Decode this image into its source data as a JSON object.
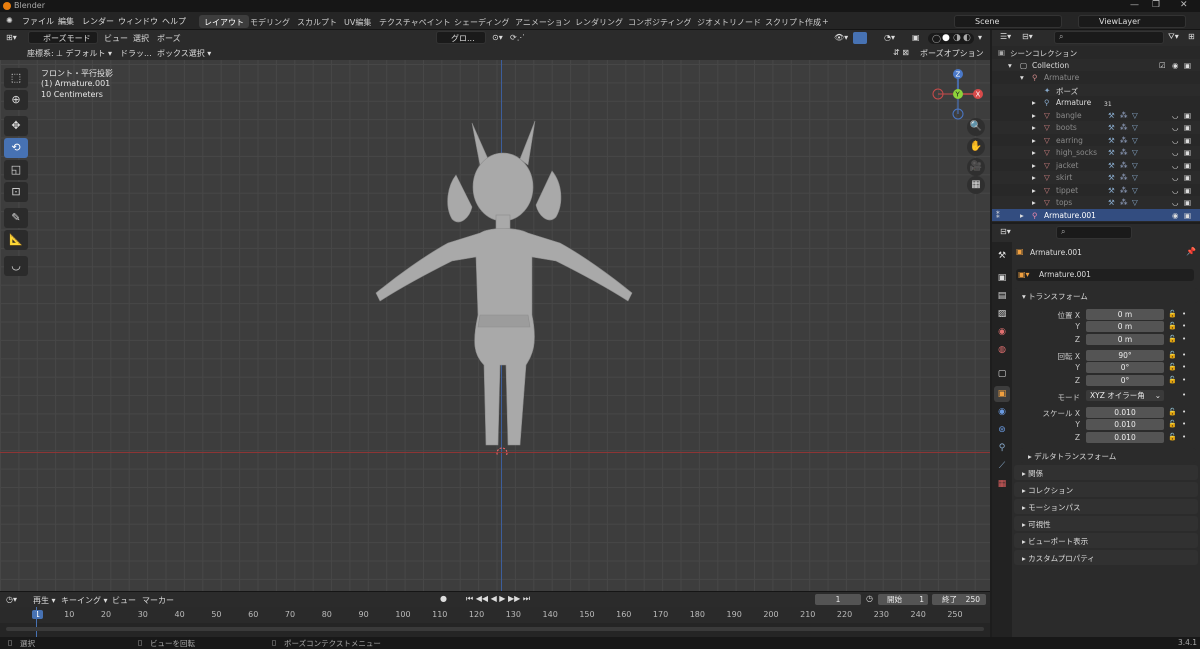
{
  "window": {
    "title": "Blender",
    "version": "3.4.1"
  },
  "menu": [
    "ファイル",
    "編集",
    "レンダー",
    "ウィンドウ",
    "ヘルプ"
  ],
  "workspaces": [
    "レイアウト",
    "モデリング",
    "スカルプト",
    "UV編集",
    "テクスチャペイント",
    "シェーディング",
    "アニメーション",
    "レンダリング",
    "コンポジティング",
    "ジオメトリノード",
    "スクリプト作成"
  ],
  "scene": {
    "name": "Scene",
    "view_layer": "ViewLayer"
  },
  "viewport_header": {
    "mode": "ポーズモード",
    "items": [
      "ビュー",
      "選択",
      "ポーズ"
    ],
    "orientation": "グロ...",
    "pose_options": "ポーズオプション"
  },
  "viewport_header2": {
    "coord_label": "座標系:",
    "coord_value": "デフォルト",
    "drag_label": "ドラッ...",
    "select_mode": "ボックス選択"
  },
  "overlay_text": {
    "view": "フロント・平行投影",
    "object": "(1) Armature.001",
    "scale": "10 Centimeters"
  },
  "gizmo": {
    "x": "X",
    "y": "Y",
    "z": "Z"
  },
  "timeline": {
    "play_label": "再生",
    "keying_label": "キーイング",
    "view_label": "ビュー",
    "marker_label": "マーカー",
    "current_frame": "1",
    "start_label": "開始",
    "start": "1",
    "end_label": "終了",
    "end": "250",
    "ticks": [
      "1",
      "10",
      "20",
      "30",
      "40",
      "50",
      "60",
      "70",
      "80",
      "90",
      "100",
      "110",
      "120",
      "130",
      "140",
      "150",
      "160",
      "170",
      "180",
      "190",
      "200",
      "210",
      "220",
      "230",
      "240",
      "250"
    ]
  },
  "statusbar": {
    "select": "選択",
    "rotate": "ビューを回転",
    "context": "ポーズコンテクストメニュー"
  },
  "outliner": {
    "scene_collection": "シーンコレクション",
    "rows": [
      {
        "label": "Collection"
      },
      {
        "label": "Armature"
      },
      {
        "label": "ポーズ"
      },
      {
        "label": "Armature",
        "badge": "31"
      },
      {
        "label": "bangle"
      },
      {
        "label": "boots"
      },
      {
        "label": "earring"
      },
      {
        "label": "high_socks"
      },
      {
        "label": "jacket"
      },
      {
        "label": "skirt"
      },
      {
        "label": "tippet"
      },
      {
        "label": "tops"
      },
      {
        "label": "Armature.001"
      }
    ]
  },
  "properties": {
    "object_name": "Armature.001",
    "data_name": "Armature.001",
    "transform_title": "トランスフォーム",
    "location_label": "位置 X",
    "y_label": "Y",
    "z_label": "Z",
    "location": [
      "0 m",
      "0 m",
      "0 m"
    ],
    "rotation_label": "回転 X",
    "rotation": [
      "90°",
      "0°",
      "0°"
    ],
    "mode_label": "モード",
    "mode_value": "XYZ オイラー角",
    "scale_label": "スケール X",
    "scale": [
      "0.010",
      "0.010",
      "0.010"
    ],
    "delta_title": "デルタトランスフォーム",
    "panels": [
      "関係",
      "コレクション",
      "モーションパス",
      "可視性",
      "ビューポート表示",
      "カスタムプロパティ"
    ]
  }
}
